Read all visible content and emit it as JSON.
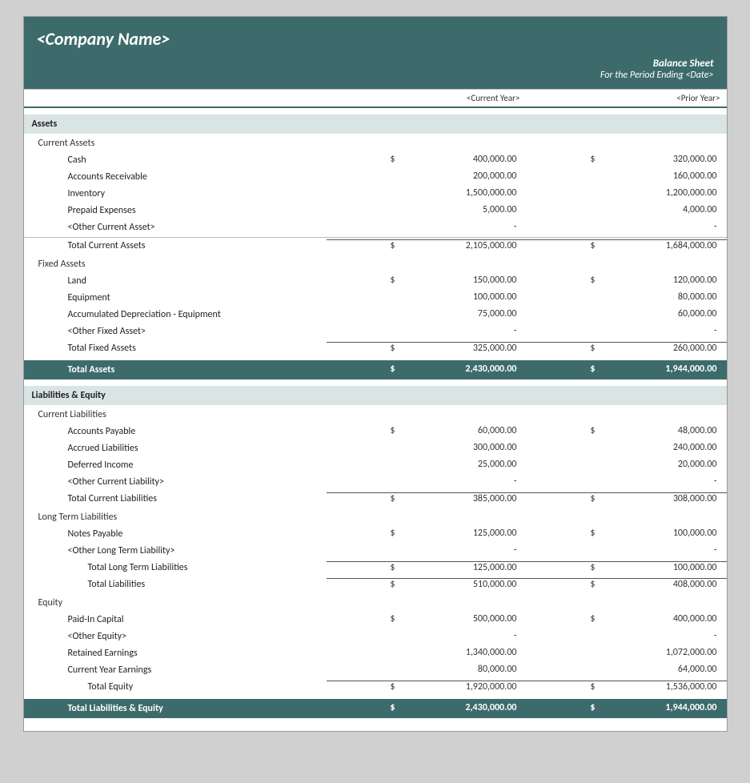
{
  "header": {
    "company_name": "<Company Name>",
    "report_title": "Balance Sheet",
    "report_subtitle": "For the Period Ending <Date>"
  },
  "columns": {
    "current_year_label": "<Current Year>",
    "prior_year_label": "<Prior Year>"
  },
  "assets": {
    "section_label": "Assets",
    "current_assets": {
      "subsection_label": "Current Assets",
      "items": [
        {
          "label": "Cash",
          "has_dollar": true,
          "current": "400,000.00",
          "prior_dollar": true,
          "prior": "320,000.00"
        },
        {
          "label": "Accounts Receivable",
          "has_dollar": false,
          "current": "200,000.00",
          "prior_dollar": false,
          "prior": "160,000.00"
        },
        {
          "label": "Inventory",
          "has_dollar": false,
          "current": "1,500,000.00",
          "prior_dollar": false,
          "prior": "1,200,000.00"
        },
        {
          "label": "Prepaid Expenses",
          "has_dollar": false,
          "current": "5,000.00",
          "prior_dollar": false,
          "prior": "4,000.00"
        },
        {
          "label": "<Other Current Asset>",
          "has_dollar": false,
          "current": "-",
          "prior_dollar": false,
          "prior": "-"
        }
      ],
      "total_label": "Total Current Assets",
      "total_current_dollar": true,
      "total_current": "2,105,000.00",
      "total_prior_dollar": true,
      "total_prior": "1,684,000.00"
    },
    "fixed_assets": {
      "subsection_label": "Fixed Assets",
      "items": [
        {
          "label": "Land",
          "has_dollar": true,
          "current": "150,000.00",
          "prior_dollar": true,
          "prior": "120,000.00"
        },
        {
          "label": "Equipment",
          "has_dollar": false,
          "current": "100,000.00",
          "prior_dollar": false,
          "prior": "80,000.00"
        },
        {
          "label": "Accumulated Depreciation - Equipment",
          "has_dollar": false,
          "current": "75,000.00",
          "prior_dollar": false,
          "prior": "60,000.00"
        },
        {
          "label": "<Other Fixed Asset>",
          "has_dollar": false,
          "current": "-",
          "prior_dollar": false,
          "prior": "-"
        }
      ],
      "total_label": "Total Fixed Assets",
      "total_current_dollar": true,
      "total_current": "325,000.00",
      "total_prior_dollar": true,
      "total_prior": "260,000.00"
    },
    "grand_total_label": "Total Assets",
    "grand_total_current_dollar": "$",
    "grand_total_current": "2,430,000.00",
    "grand_total_prior_dollar": "$",
    "grand_total_prior": "1,944,000.00"
  },
  "liabilities_equity": {
    "section_label": "Liabilities & Equity",
    "current_liabilities": {
      "subsection_label": "Current Liabilities",
      "items": [
        {
          "label": "Accounts Payable",
          "has_dollar": true,
          "current": "60,000.00",
          "prior_dollar": true,
          "prior": "48,000.00"
        },
        {
          "label": "Accrued Liabilities",
          "has_dollar": false,
          "current": "300,000.00",
          "prior_dollar": false,
          "prior": "240,000.00"
        },
        {
          "label": "Deferred Income",
          "has_dollar": false,
          "current": "25,000.00",
          "prior_dollar": false,
          "prior": "20,000.00"
        },
        {
          "label": "<Other Current Liability>",
          "has_dollar": false,
          "current": "-",
          "prior_dollar": false,
          "prior": "-"
        }
      ],
      "total_label": "Total Current Liabilities",
      "total_current_dollar": true,
      "total_current": "385,000.00",
      "total_prior_dollar": true,
      "total_prior": "308,000.00"
    },
    "long_term_liabilities": {
      "subsection_label": "Long Term Liabilities",
      "items": [
        {
          "label": "Notes Payable",
          "has_dollar": true,
          "current": "125,000.00",
          "prior_dollar": true,
          "prior": "100,000.00"
        },
        {
          "label": "<Other Long Term Liability>",
          "has_dollar": false,
          "current": "-",
          "prior_dollar": false,
          "prior": "-"
        }
      ],
      "total_long_term_label": "Total Long Term Liabilities",
      "total_long_term_current_dollar": true,
      "total_long_term_current": "125,000.00",
      "total_long_term_prior_dollar": true,
      "total_long_term_prior": "100,000.00",
      "total_liabilities_label": "Total Liabilities",
      "total_liabilities_current_dollar": true,
      "total_liabilities_current": "510,000.00",
      "total_liabilities_prior_dollar": true,
      "total_liabilities_prior": "408,000.00"
    },
    "equity": {
      "subsection_label": "Equity",
      "items": [
        {
          "label": "Paid-In Capital",
          "has_dollar": true,
          "current": "500,000.00",
          "prior_dollar": true,
          "prior": "400,000.00"
        },
        {
          "label": "<Other Equity>",
          "has_dollar": false,
          "current": "-",
          "prior_dollar": false,
          "prior": "-"
        },
        {
          "label": "Retained Earnings",
          "has_dollar": false,
          "current": "1,340,000.00",
          "prior_dollar": false,
          "prior": "1,072,000.00"
        },
        {
          "label": "Current Year Earnings",
          "has_dollar": false,
          "current": "80,000.00",
          "prior_dollar": false,
          "prior": "64,000.00"
        }
      ],
      "total_equity_label": "Total Equity",
      "total_equity_current_dollar": true,
      "total_equity_current": "1,920,000.00",
      "total_equity_prior_dollar": true,
      "total_equity_prior": "1,536,000.00"
    },
    "grand_total_label": "Total Liabilities & Equity",
    "grand_total_current_dollar": "$",
    "grand_total_current": "2,430,000.00",
    "grand_total_prior_dollar": "$",
    "grand_total_prior": "1,944,000.00"
  }
}
